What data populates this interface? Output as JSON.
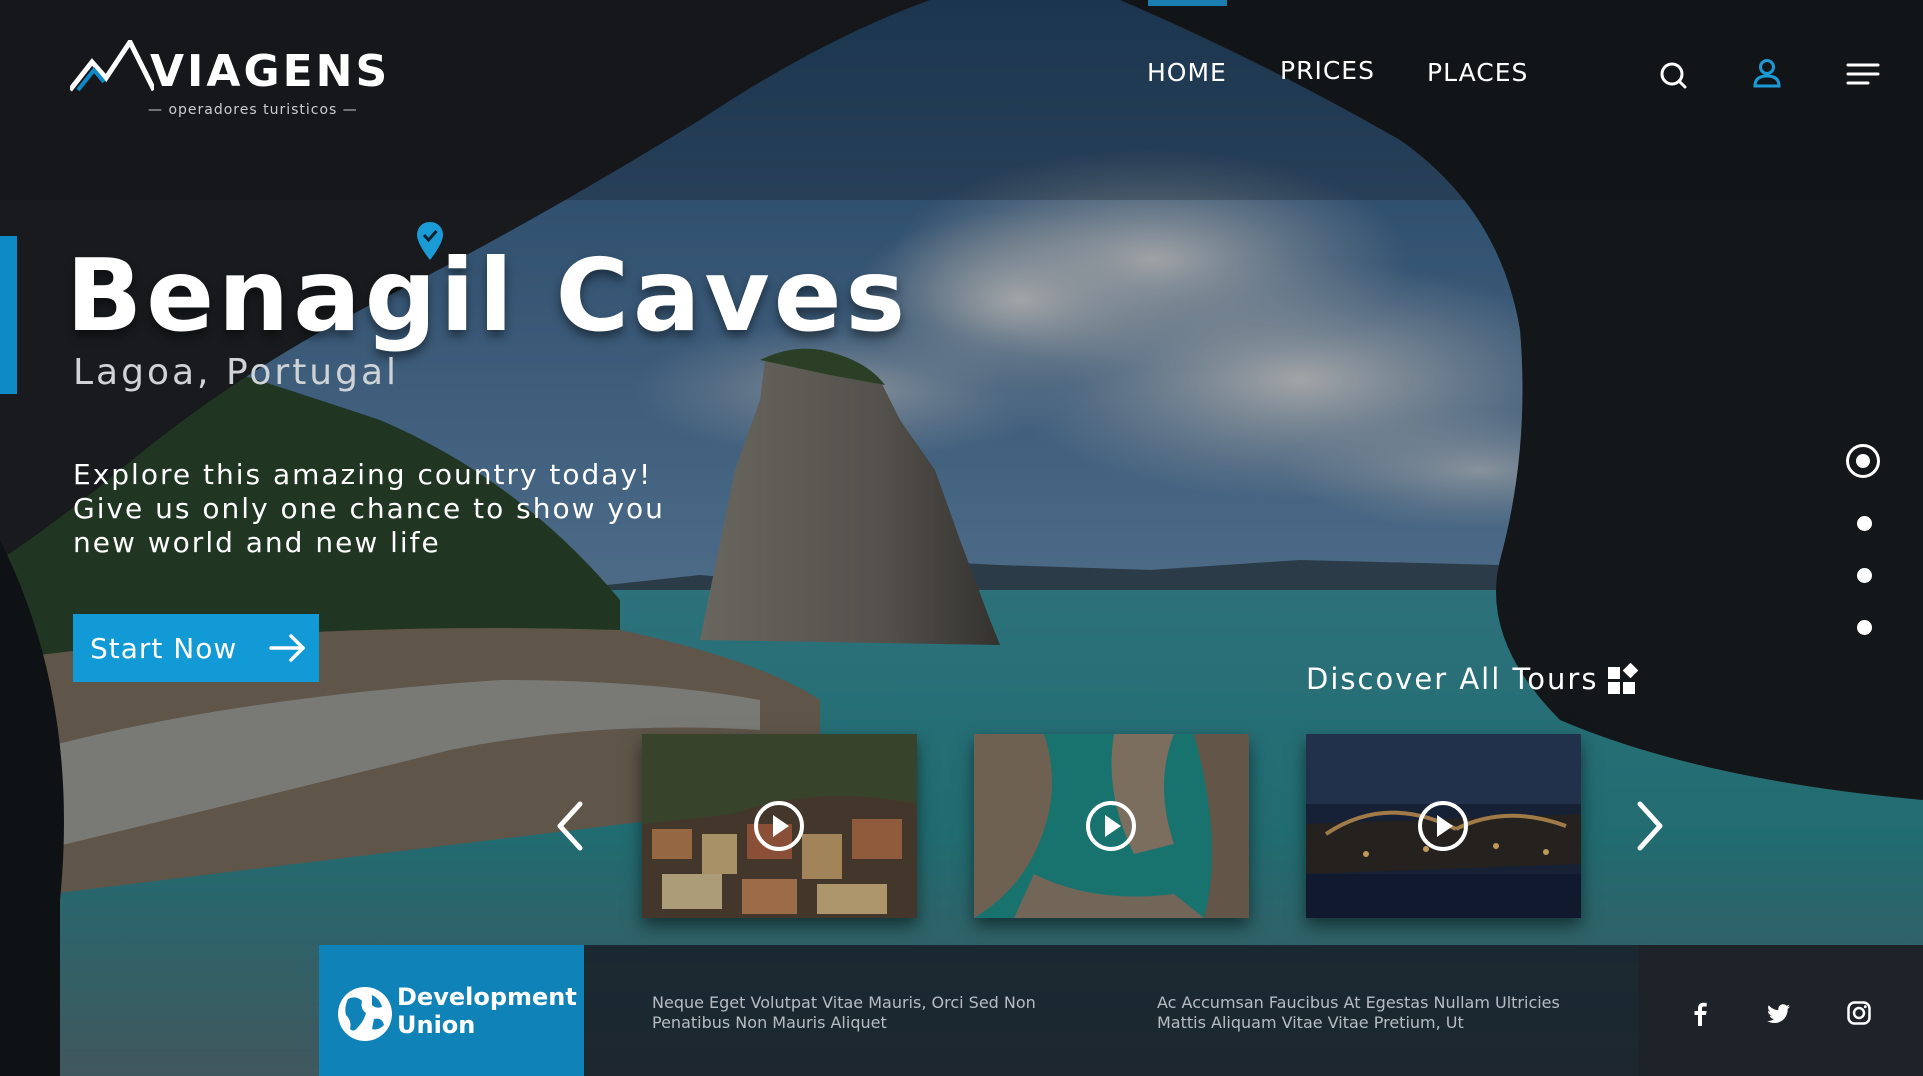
{
  "brand": {
    "name": "VIAGENS",
    "tagline": "— operadores turisticos —",
    "accent_color": "#0e8bc6"
  },
  "nav": {
    "items": [
      {
        "label": "HOME",
        "active": true
      },
      {
        "label": "PRICES",
        "active": false
      },
      {
        "label": "PLACES",
        "active": false
      }
    ]
  },
  "header_icons": [
    "search-icon",
    "user-icon",
    "menu-icon"
  ],
  "hero": {
    "title": "Benagil Caves",
    "location": "Lagoa, Portugal",
    "description": [
      "Explore this amazing country today!",
      "Give us only one chance to show you",
      "new world and new life"
    ],
    "cta_label": "Start Now"
  },
  "slider": {
    "count": 4,
    "active_index": 0
  },
  "tours": {
    "discover_label": "Discover All Tours",
    "items": [
      {
        "name": "coastal-town",
        "icon": "play-icon"
      },
      {
        "name": "turquoise-bay",
        "icon": "play-icon"
      },
      {
        "name": "night-bridge-city",
        "icon": "play-icon"
      }
    ]
  },
  "footer": {
    "partner": [
      "Development",
      "Union"
    ],
    "info_left": [
      "Neque Eget Volutpat Vitae Mauris, Orci Sed Non",
      "Penatibus Non Mauris Aliquet"
    ],
    "info_right": [
      "Ac Accumsan Faucibus At Egestas Nullam Ultricies",
      "Mattis Aliquam Vitae Vitae Pretium, Ut"
    ],
    "social": [
      "facebook-icon",
      "twitter-icon",
      "instagram-icon"
    ]
  }
}
